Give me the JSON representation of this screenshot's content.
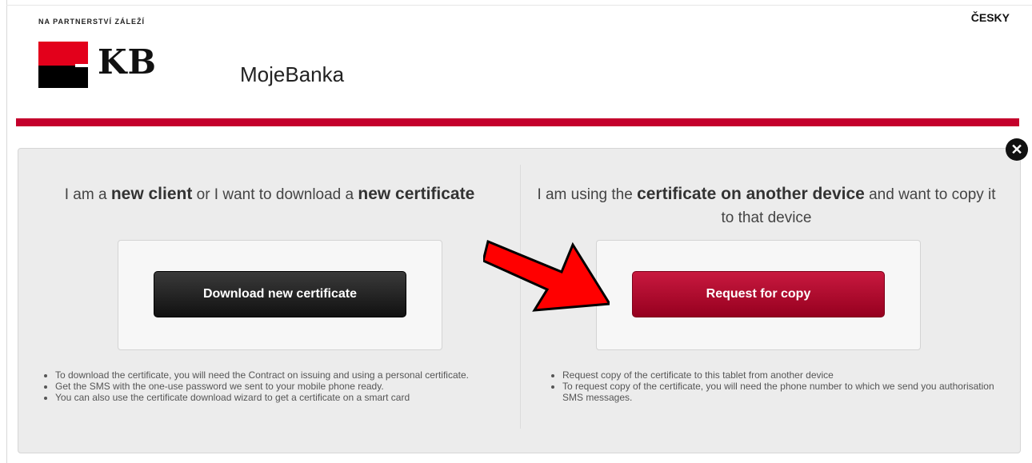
{
  "header": {
    "tagline": "NA PARTNERSTVÍ ZÁLEŽÍ",
    "language_link": "ČESKY",
    "logo_text": "KB",
    "app_title": "MojeBanka"
  },
  "colors": {
    "brand_red": "#c4002c",
    "logo_red": "#e3001b",
    "dark_button": "#1a1a1a",
    "annotation_arrow": "#ff0000"
  },
  "left": {
    "title_prefix": "I am a",
    "title_bold1": "new client",
    "title_middle": "or I want to download a",
    "title_bold2": "new certificate",
    "button_label": "Download new certificate",
    "notes": [
      "To download the certificate, you will need the Contract on issuing and using a personal certificate.",
      "Get the SMS with the one-use password we sent to your mobile phone ready.",
      "You can also use the certificate download wizard to get a certificate on a smart card"
    ]
  },
  "right": {
    "title_prefix": "I am using the",
    "title_bold": "certificate on another device",
    "title_suffix": "and want to copy it to that device",
    "button_label": "Request for copy",
    "notes": [
      "Request copy of the certificate to this tablet from another device",
      "To request copy of the certificate, you will need the phone number to which we send you authorisation SMS messages."
    ]
  },
  "icons": {
    "close": "close-icon",
    "annotation": "arrow-right-icon"
  }
}
